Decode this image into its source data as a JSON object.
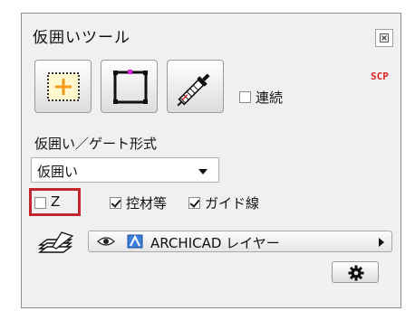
{
  "window": {
    "title": "仮囲いツール"
  },
  "badge": {
    "text": "SCP",
    "color": "#e02020"
  },
  "tools": [
    {
      "icon": "add-selection-icon"
    },
    {
      "icon": "rectangle-outline-icon"
    },
    {
      "icon": "eyedropper-icon"
    }
  ],
  "options": {
    "continuous_label": "連続",
    "continuous_checked": false,
    "z_label": "Z",
    "z_checked": false,
    "hikae_label": "控材等",
    "hikae_checked": true,
    "guide_label": "ガイド線",
    "guide_checked": true
  },
  "form_type": {
    "label": "仮囲い／ゲート形式",
    "selected": "仮囲い"
  },
  "layer": {
    "value": "ARCHICAD レイヤー",
    "icons": [
      "layers-icon",
      "eye-icon",
      "archicad-layer-icon"
    ]
  },
  "highlight_color": "#c0262c"
}
